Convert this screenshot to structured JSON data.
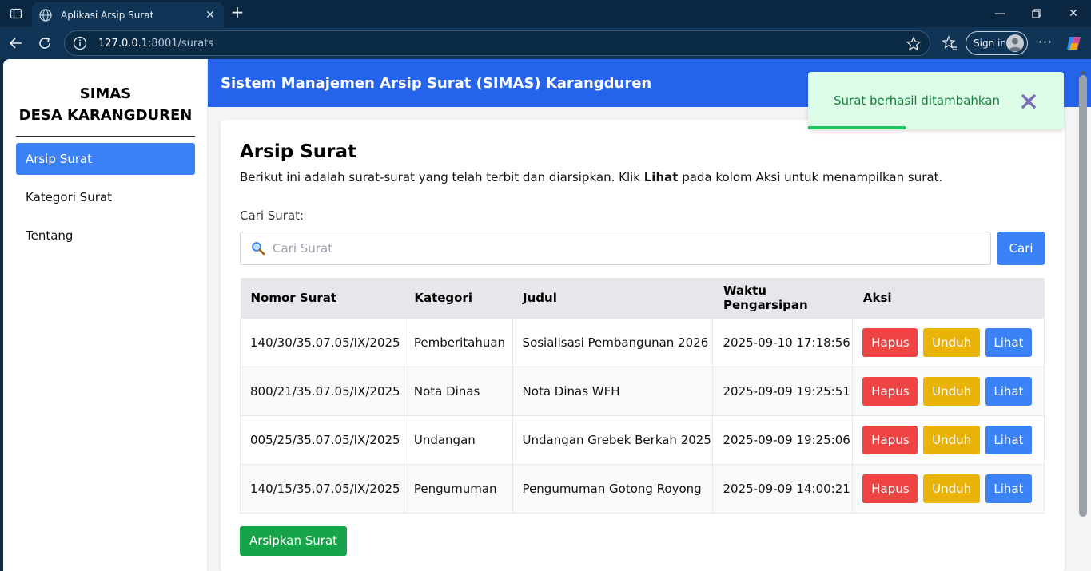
{
  "browser": {
    "tab_title": "Aplikasi Arsip Surat",
    "url_host": "127.0.0.1",
    "url_rest": ":8001/surats",
    "signin_label": "Sign in"
  },
  "sidebar": {
    "brand_line1": "SIMAS",
    "brand_line2": "DESA KARANGDUREN",
    "items": [
      {
        "label": "Arsip Surat",
        "active": true
      },
      {
        "label": "Kategori Surat",
        "active": false
      },
      {
        "label": "Tentang",
        "active": false
      }
    ]
  },
  "header": {
    "title": "Sistem Manajemen Arsip Surat (SIMAS) Karangduren"
  },
  "main": {
    "title": "Arsip Surat",
    "desc_before": "Berikut ini adalah surat-surat yang telah terbit dan diarsipkan. Klik ",
    "desc_bold": "Lihat",
    "desc_after": " pada kolom Aksi untuk menampilkan surat.",
    "search_label": "Cari Surat:",
    "search_placeholder": "Cari Surat",
    "search_value": "",
    "search_button": "Cari",
    "add_button": "Arsipkan Surat"
  },
  "table": {
    "headers": [
      "Nomor Surat",
      "Kategori",
      "Judul",
      "Waktu Pengarsipan",
      "Aksi"
    ],
    "action_labels": {
      "hapus": "Hapus",
      "unduh": "Unduh",
      "lihat": "Lihat"
    },
    "rows": [
      {
        "nomor": "140/30/35.07.05/IX/2025",
        "kategori": "Pemberitahuan",
        "judul": "Sosialisasi Pembangunan 2026",
        "waktu": "2025-09-10 17:18:56"
      },
      {
        "nomor": "800/21/35.07.05/IX/2025",
        "kategori": "Nota Dinas",
        "judul": "Nota Dinas WFH",
        "waktu": "2025-09-09 19:25:51"
      },
      {
        "nomor": "005/25/35.07.05/IX/2025",
        "kategori": "Undangan",
        "judul": "Undangan Grebek Berkah 2025",
        "waktu": "2025-09-09 19:25:06"
      },
      {
        "nomor": "140/15/35.07.05/IX/2025",
        "kategori": "Pengumuman",
        "judul": "Pengumuman Gotong Royong",
        "waktu": "2025-09-09 14:00:21"
      }
    ]
  },
  "toast": {
    "message": "Surat berhasil ditambahkan",
    "progress": 0.38
  },
  "colors": {
    "header_bg": "#2563eb",
    "active_nav": "#3b82f6",
    "hapus": "#ef4444",
    "unduh": "#eab308",
    "lihat": "#3b82f6",
    "add": "#16a34a",
    "toast_bg": "#dcfce7",
    "toast_text": "#15803d"
  },
  "icons": [
    "sidebar-toggle-icon",
    "globe-icon",
    "close-icon",
    "plus-icon",
    "minimize-icon",
    "maximize-icon",
    "back-icon",
    "reload-icon",
    "info-icon",
    "star-icon",
    "favorites-icon",
    "avatar-icon",
    "more-icon",
    "copilot-icon",
    "search-icon",
    "close-x-icon"
  ]
}
